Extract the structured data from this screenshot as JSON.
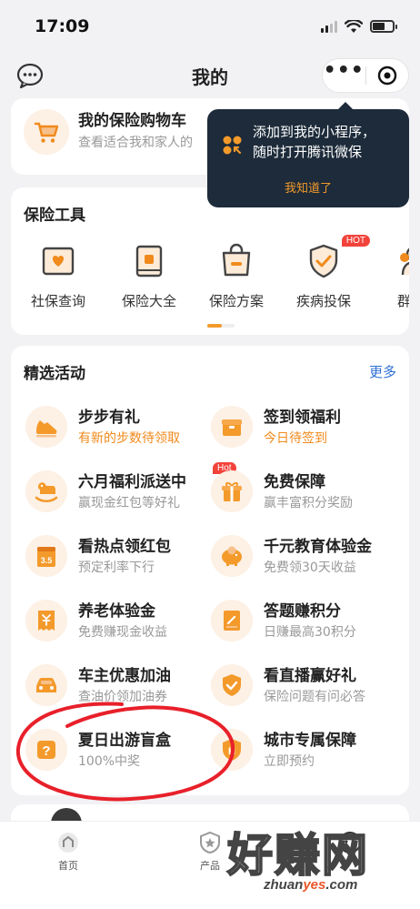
{
  "status_bar": {
    "time": "17:09"
  },
  "nav": {
    "title": "我的"
  },
  "cart": {
    "title": "我的保险购物车",
    "subtitle": "查看适合我和家人的"
  },
  "tooltip": {
    "text": "添加到我的小程序，\n随时打开腾讯微保",
    "confirm": "我知道了"
  },
  "tools": {
    "title": "保险工具",
    "items": [
      {
        "label": "社保查询",
        "icon": "social-security-icon"
      },
      {
        "label": "保险大全",
        "icon": "insurance-book-icon"
      },
      {
        "label": "保险方案",
        "icon": "insurance-bag-icon"
      },
      {
        "label": "疾病投保",
        "icon": "shield-check-icon",
        "badge": "HOT"
      },
      {
        "label": "群投",
        "icon": "group-icon"
      }
    ]
  },
  "activities": {
    "title": "精选活动",
    "more": "更多",
    "items": [
      {
        "title": "步步有礼",
        "subtitle": "有新的步数待领取",
        "icon": "sneaker-icon"
      },
      {
        "title": "签到领福利",
        "subtitle": "今日待签到",
        "icon": "gift-box-icon"
      },
      {
        "title": "六月福利派送中",
        "subtitle": "赢现金红包等好礼",
        "icon": "rocking-horse-icon",
        "badge": "Hot"
      },
      {
        "title": "免费保障",
        "subtitle": "赢丰富积分奖励",
        "icon": "present-icon"
      },
      {
        "title": "看热点领红包",
        "subtitle": "预定利率下行",
        "icon": "calendar-icon",
        "icon_text": "3.5"
      },
      {
        "title": "千元教育体验金",
        "subtitle": "免费领30天收益",
        "icon": "piggy-bank-icon"
      },
      {
        "title": "养老体验金",
        "subtitle": "免费赚现金收益",
        "icon": "yuan-receipt-icon"
      },
      {
        "title": "答题赚积分",
        "subtitle": "日赚最高30积分",
        "icon": "notebook-icon"
      },
      {
        "title": "车主优惠加油",
        "subtitle": "查油价领加油券",
        "icon": "car-icon"
      },
      {
        "title": "看直播赢好礼",
        "subtitle": "保险问题有问必答",
        "icon": "shield-badge-icon"
      },
      {
        "title": "夏日出游盲盒",
        "subtitle": "100%中奖",
        "icon": "mystery-box-icon"
      },
      {
        "title": "城市专属保障",
        "subtitle": "立即预约",
        "icon": "city-shield-icon"
      }
    ]
  },
  "tab_bar": {
    "home": "首页",
    "products": "产品"
  },
  "watermark": {
    "big": "好赚网",
    "domain_a": "zhuan",
    "domain_b": "yes",
    "domain_c": ".com"
  },
  "colors": {
    "accent": "#f39a2b",
    "link": "#2f6fd6",
    "tooltip_bg": "#1d2b3a",
    "hot": "#f2433b"
  }
}
